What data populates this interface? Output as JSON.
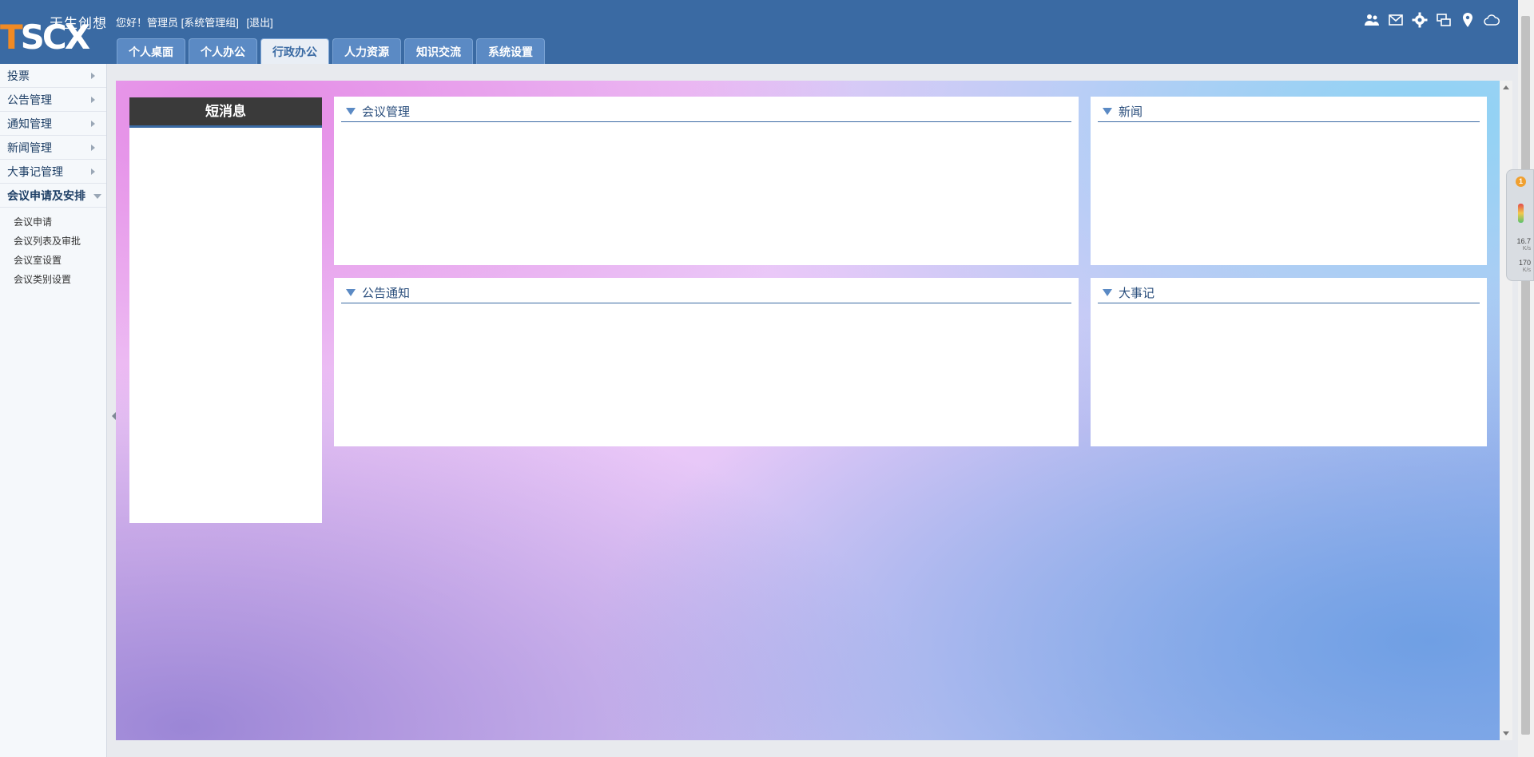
{
  "brand": {
    "logo_text": "TSCX",
    "logo_cn": "天生创想",
    "accent": "#3a6aa3",
    "logo_orange": "#f08a24"
  },
  "header": {
    "welcome": "您好！管理员 [系统管理组]",
    "logout": "[退出]",
    "tabs": [
      "个人桌面",
      "个人办公",
      "行政办公",
      "人力资源",
      "知识交流",
      "系统设置"
    ],
    "active_tab": "行政办公",
    "tool_icons": [
      "users-icon",
      "mail-icon",
      "gear-icon",
      "screens-icon",
      "location-icon",
      "cloud-icon"
    ]
  },
  "sidebar": {
    "items": [
      "投票",
      "公告管理",
      "通知管理",
      "新闻管理",
      "大事记管理"
    ],
    "open_item": "会议申请及安排",
    "sub_items": [
      "会议申请",
      "会议列表及审批",
      "会议室设置",
      "会议类别设置"
    ]
  },
  "main": {
    "message_panel_title": "短消息",
    "portlets": {
      "meeting": "会议管理",
      "news": "新闻",
      "notice": "公告通知",
      "events": "大事记"
    }
  },
  "float_widget": {
    "badge": "1",
    "speed_up": "16.7",
    "speed_up_unit": "K/s",
    "speed_down": "170",
    "speed_down_unit": "K/s"
  }
}
